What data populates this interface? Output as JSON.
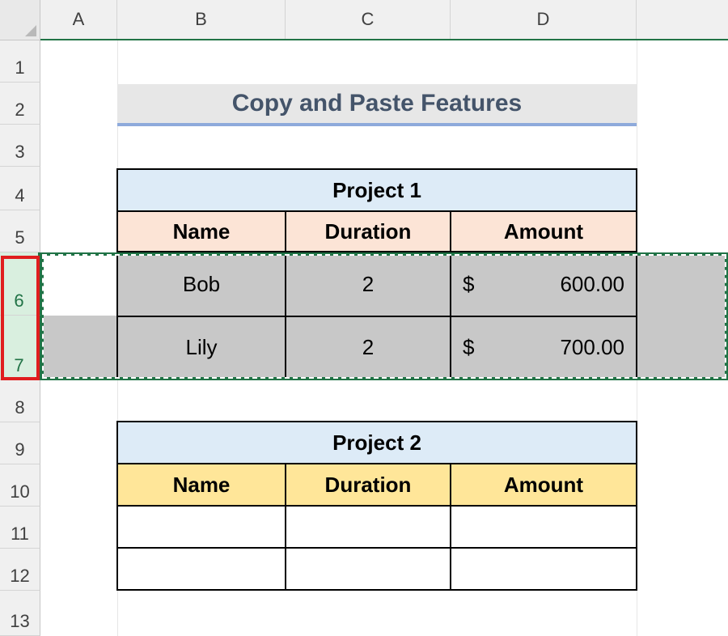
{
  "columns": [
    "A",
    "B",
    "C",
    "D"
  ],
  "rows": [
    "1",
    "2",
    "3",
    "4",
    "5",
    "6",
    "7",
    "8",
    "9",
    "10",
    "11",
    "12",
    "13"
  ],
  "selected_rows": [
    "6",
    "7"
  ],
  "title": "Copy and Paste Features",
  "project1": {
    "title": "Project 1",
    "headers": [
      "Name",
      "Duration",
      "Amount"
    ],
    "data": [
      {
        "name": "Bob",
        "duration": "2",
        "currency": "$",
        "amount": "600.00"
      },
      {
        "name": "Lily",
        "duration": "2",
        "currency": "$",
        "amount": "700.00"
      }
    ]
  },
  "project2": {
    "title": "Project 2",
    "headers": [
      "Name",
      "Duration",
      "Amount"
    ]
  },
  "colors": {
    "project_title_fill": "#ddebf7",
    "project1_header_fill": "#fce4d6",
    "project2_header_fill": "#ffe699",
    "copied_range_fill": "#c8c8c8",
    "marquee": "#217346",
    "row_selection_outline": "#e01e1e"
  }
}
